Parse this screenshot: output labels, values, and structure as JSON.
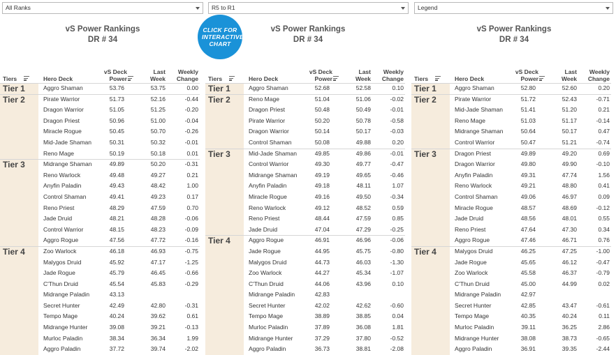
{
  "filters": [
    {
      "label": "All Ranks"
    },
    {
      "label": "R5 to R1"
    },
    {
      "label": "Legend"
    }
  ],
  "badge": {
    "text": "CLICK FOR INTERACTIVE CHART"
  },
  "headers": {
    "tiers": "Tiers",
    "deck": "Hero Deck",
    "power": "vS Deck Power",
    "last": "Last Week",
    "change": "Weekly Change"
  },
  "chart_data": [
    {
      "type": "table",
      "title": "vS Power Rankings",
      "subtitle": "DR # 34",
      "filter": "All Ranks",
      "rows": [
        {
          "tier": "Tier 1",
          "deck": "Aggro Shaman",
          "power": "53.76",
          "last": "53.75",
          "change": "0.00"
        },
        {
          "tier": "Tier 2",
          "deck": "Pirate Warrior",
          "power": "51.73",
          "last": "52.16",
          "change": "-0.44"
        },
        {
          "tier": "",
          "deck": "Dragon Warrior",
          "power": "51.05",
          "last": "51.25",
          "change": "-0.20"
        },
        {
          "tier": "",
          "deck": "Dragon Priest",
          "power": "50.96",
          "last": "51.00",
          "change": "-0.04"
        },
        {
          "tier": "",
          "deck": "Miracle Rogue",
          "power": "50.45",
          "last": "50.70",
          "change": "-0.26"
        },
        {
          "tier": "",
          "deck": "Mid-Jade Shaman",
          "power": "50.31",
          "last": "50.32",
          "change": "-0.01"
        },
        {
          "tier": "",
          "deck": "Reno Mage",
          "power": "50.19",
          "last": "50.18",
          "change": "0.01"
        },
        {
          "tier": "Tier 3",
          "deck": "Midrange Shaman",
          "power": "49.89",
          "last": "50.20",
          "change": "-0.31"
        },
        {
          "tier": "",
          "deck": "Reno Warlock",
          "power": "49.48",
          "last": "49.27",
          "change": "0.21"
        },
        {
          "tier": "",
          "deck": "Anyfin Paladin",
          "power": "49.43",
          "last": "48.42",
          "change": "1.00"
        },
        {
          "tier": "",
          "deck": "Control Shaman",
          "power": "49.41",
          "last": "49.23",
          "change": "0.17"
        },
        {
          "tier": "",
          "deck": "Reno Priest",
          "power": "48.29",
          "last": "47.59",
          "change": "0.70"
        },
        {
          "tier": "",
          "deck": "Jade Druid",
          "power": "48.21",
          "last": "48.28",
          "change": "-0.06"
        },
        {
          "tier": "",
          "deck": "Control Warrior",
          "power": "48.15",
          "last": "48.23",
          "change": "-0.09"
        },
        {
          "tier": "",
          "deck": "Aggro Rogue",
          "power": "47.56",
          "last": "47.72",
          "change": "-0.16"
        },
        {
          "tier": "Tier 4",
          "deck": "Zoo Warlock",
          "power": "46.18",
          "last": "46.93",
          "change": "-0.75"
        },
        {
          "tier": "",
          "deck": "Malygos Druid",
          "power": "45.92",
          "last": "47.17",
          "change": "-1.25"
        },
        {
          "tier": "",
          "deck": "Jade Rogue",
          "power": "45.79",
          "last": "46.45",
          "change": "-0.66"
        },
        {
          "tier": "",
          "deck": "C'Thun Druid",
          "power": "45.54",
          "last": "45.83",
          "change": "-0.29"
        },
        {
          "tier": "",
          "deck": "Midrange Paladin",
          "power": "43.13",
          "last": "",
          "change": ""
        },
        {
          "tier": "",
          "deck": "Secret Hunter",
          "power": "42.49",
          "last": "42.80",
          "change": "-0.31"
        },
        {
          "tier": "",
          "deck": "Tempo Mage",
          "power": "40.24",
          "last": "39.62",
          "change": "0.61"
        },
        {
          "tier": "",
          "deck": "Midrange Hunter",
          "power": "39.08",
          "last": "39.21",
          "change": "-0.13"
        },
        {
          "tier": "",
          "deck": "Murloc Paladin",
          "power": "38.34",
          "last": "36.34",
          "change": "1.99"
        },
        {
          "tier": "",
          "deck": "Aggro Paladin",
          "power": "37.72",
          "last": "39.74",
          "change": "-2.02"
        }
      ]
    },
    {
      "type": "table",
      "title": "vS Power Rankings",
      "subtitle": "DR # 34",
      "filter": "R5 to R1",
      "rows": [
        {
          "tier": "Tier 1",
          "deck": "Aggro Shaman",
          "power": "52.68",
          "last": "52.58",
          "change": "0.10"
        },
        {
          "tier": "Tier 2",
          "deck": "Reno Mage",
          "power": "51.04",
          "last": "51.06",
          "change": "-0.02"
        },
        {
          "tier": "",
          "deck": "Dragon Priest",
          "power": "50.48",
          "last": "50.49",
          "change": "-0.01"
        },
        {
          "tier": "",
          "deck": "Pirate Warrior",
          "power": "50.20",
          "last": "50.78",
          "change": "-0.58"
        },
        {
          "tier": "",
          "deck": "Dragon Warrior",
          "power": "50.14",
          "last": "50.17",
          "change": "-0.03"
        },
        {
          "tier": "",
          "deck": "Control Shaman",
          "power": "50.08",
          "last": "49.88",
          "change": "0.20"
        },
        {
          "tier": "Tier 3",
          "deck": "Mid-Jade Shaman",
          "power": "49.85",
          "last": "49.86",
          "change": "-0.01"
        },
        {
          "tier": "",
          "deck": "Control Warrior",
          "power": "49.30",
          "last": "49.77",
          "change": "-0.47"
        },
        {
          "tier": "",
          "deck": "Midrange Shaman",
          "power": "49.19",
          "last": "49.65",
          "change": "-0.46"
        },
        {
          "tier": "",
          "deck": "Anyfin Paladin",
          "power": "49.18",
          "last": "48.11",
          "change": "1.07"
        },
        {
          "tier": "",
          "deck": "Miracle Rogue",
          "power": "49.16",
          "last": "49.50",
          "change": "-0.34"
        },
        {
          "tier": "",
          "deck": "Reno Warlock",
          "power": "49.12",
          "last": "48.52",
          "change": "0.59"
        },
        {
          "tier": "",
          "deck": "Reno Priest",
          "power": "48.44",
          "last": "47.59",
          "change": "0.85"
        },
        {
          "tier": "",
          "deck": "Jade Druid",
          "power": "47.04",
          "last": "47.29",
          "change": "-0.25"
        },
        {
          "tier": "Tier 4",
          "deck": "Aggro Rogue",
          "power": "46.91",
          "last": "46.96",
          "change": "-0.06"
        },
        {
          "tier": "",
          "deck": "Jade Rogue",
          "power": "44.95",
          "last": "45.75",
          "change": "-0.80"
        },
        {
          "tier": "",
          "deck": "Malygos Druid",
          "power": "44.73",
          "last": "46.03",
          "change": "-1.30"
        },
        {
          "tier": "",
          "deck": "Zoo Warlock",
          "power": "44.27",
          "last": "45.34",
          "change": "-1.07"
        },
        {
          "tier": "",
          "deck": "C'Thun Druid",
          "power": "44.06",
          "last": "43.96",
          "change": "0.10"
        },
        {
          "tier": "",
          "deck": "Midrange Paladin",
          "power": "42.83",
          "last": "",
          "change": ""
        },
        {
          "tier": "",
          "deck": "Secret Hunter",
          "power": "42.02",
          "last": "42.62",
          "change": "-0.60"
        },
        {
          "tier": "",
          "deck": "Tempo Mage",
          "power": "38.89",
          "last": "38.85",
          "change": "0.04"
        },
        {
          "tier": "",
          "deck": "Murloc Paladin",
          "power": "37.89",
          "last": "36.08",
          "change": "1.81"
        },
        {
          "tier": "",
          "deck": "Midrange Hunter",
          "power": "37.29",
          "last": "37.80",
          "change": "-0.52"
        },
        {
          "tier": "",
          "deck": "Aggro Paladin",
          "power": "36.73",
          "last": "38.81",
          "change": "-2.08"
        }
      ]
    },
    {
      "type": "table",
      "title": "vS Power Rankings",
      "subtitle": "DR # 34",
      "filter": "Legend",
      "rows": [
        {
          "tier": "Tier 1",
          "deck": "Aggro Shaman",
          "power": "52.80",
          "last": "52.60",
          "change": "0.20"
        },
        {
          "tier": "Tier 2",
          "deck": "Pirate Warrior",
          "power": "51.72",
          "last": "52.43",
          "change": "-0.71"
        },
        {
          "tier": "",
          "deck": "Mid-Jade Shaman",
          "power": "51.41",
          "last": "51.20",
          "change": "0.21"
        },
        {
          "tier": "",
          "deck": "Reno Mage",
          "power": "51.03",
          "last": "51.17",
          "change": "-0.14"
        },
        {
          "tier": "",
          "deck": "Midrange Shaman",
          "power": "50.64",
          "last": "50.17",
          "change": "0.47"
        },
        {
          "tier": "",
          "deck": "Control Warrior",
          "power": "50.47",
          "last": "51.21",
          "change": "-0.74"
        },
        {
          "tier": "Tier 3",
          "deck": "Dragon Priest",
          "power": "49.89",
          "last": "49.20",
          "change": "0.69"
        },
        {
          "tier": "",
          "deck": "Dragon Warrior",
          "power": "49.80",
          "last": "49.90",
          "change": "-0.10"
        },
        {
          "tier": "",
          "deck": "Anyfin Paladin",
          "power": "49.31",
          "last": "47.74",
          "change": "1.56"
        },
        {
          "tier": "",
          "deck": "Reno Warlock",
          "power": "49.21",
          "last": "48.80",
          "change": "0.41"
        },
        {
          "tier": "",
          "deck": "Control Shaman",
          "power": "49.06",
          "last": "46.97",
          "change": "0.09"
        },
        {
          "tier": "",
          "deck": "Miracle Rogue",
          "power": "48.57",
          "last": "48.69",
          "change": "-0.12"
        },
        {
          "tier": "",
          "deck": "Jade Druid",
          "power": "48.56",
          "last": "48.01",
          "change": "0.55"
        },
        {
          "tier": "",
          "deck": "Reno Priest",
          "power": "47.64",
          "last": "47.30",
          "change": "0.34"
        },
        {
          "tier": "",
          "deck": "Aggro Rogue",
          "power": "47.46",
          "last": "46.71",
          "change": "0.76"
        },
        {
          "tier": "Tier 4",
          "deck": "Malygos Druid",
          "power": "46.25",
          "last": "47.25",
          "change": "-1.00"
        },
        {
          "tier": "",
          "deck": "Jade Rogue",
          "power": "45.65",
          "last": "46.12",
          "change": "-0.47"
        },
        {
          "tier": "",
          "deck": "Zoo Warlock",
          "power": "45.58",
          "last": "46.37",
          "change": "-0.79"
        },
        {
          "tier": "",
          "deck": "C'Thun Druid",
          "power": "45.00",
          "last": "44.99",
          "change": "0.02"
        },
        {
          "tier": "",
          "deck": "Midrange Paladin",
          "power": "42.97",
          "last": "",
          "change": ""
        },
        {
          "tier": "",
          "deck": "Secret Hunter",
          "power": "42.85",
          "last": "43.47",
          "change": "-0.61"
        },
        {
          "tier": "",
          "deck": "Tempo Mage",
          "power": "40.35",
          "last": "40.24",
          "change": "0.11"
        },
        {
          "tier": "",
          "deck": "Murloc Paladin",
          "power": "39.11",
          "last": "36.25",
          "change": "2.86"
        },
        {
          "tier": "",
          "deck": "Midrange Hunter",
          "power": "38.08",
          "last": "38.73",
          "change": "-0.65"
        },
        {
          "tier": "",
          "deck": "Aggro Paladin",
          "power": "36.91",
          "last": "39.35",
          "change": "-2.44"
        }
      ]
    }
  ]
}
